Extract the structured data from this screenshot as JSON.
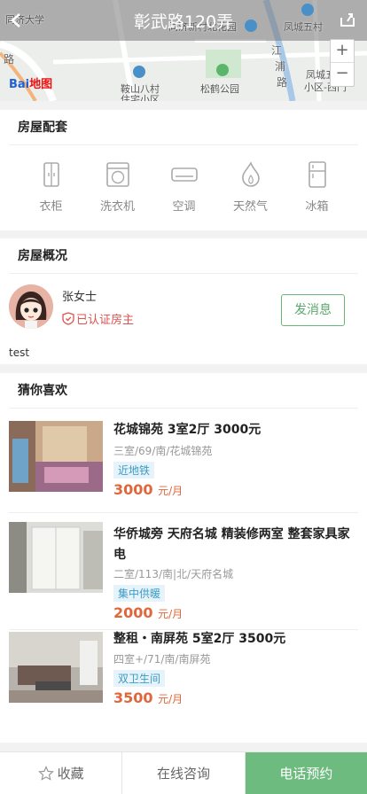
{
  "header": {
    "title": "彰武路120弄",
    "map_labels": {
      "label1": "同济大学",
      "label2": "同济新村北花园",
      "label3": "凤城五村",
      "label4": "鞍山八村",
      "label4b": "住宅小区",
      "label5": "松鹤公园",
      "label6": "凤城五",
      "label6b": "小区-西门",
      "label7": "江",
      "label8": "浦",
      "label9": "路",
      "label10": "路"
    },
    "baidu_logo": "Bai",
    "baidu_logo_suffix": "地图",
    "zoom_in": "+",
    "zoom_out": "−"
  },
  "facilities_section": {
    "title": "房屋配套",
    "items": [
      {
        "label": "衣柜",
        "icon": "wardrobe-icon"
      },
      {
        "label": "洗衣机",
        "icon": "washing-machine-icon"
      },
      {
        "label": "空调",
        "icon": "air-conditioner-icon"
      },
      {
        "label": "天然气",
        "icon": "gas-flame-icon"
      },
      {
        "label": "冰箱",
        "icon": "fridge-icon"
      }
    ]
  },
  "overview_section": {
    "title": "房屋概况",
    "owner_name": "张女士",
    "verified_label": "已认证房主",
    "message_button": "发消息",
    "description": "test"
  },
  "recommend_section": {
    "title": "猜你喜欢",
    "listings": [
      {
        "title": "花城锦苑 3室2厅 3000元",
        "meta": "三室/69/南/花城锦苑",
        "tag": "近地铁",
        "price": "3000",
        "unit": "元/月"
      },
      {
        "title": "华侨城旁 天府名城 精装修两室 整套家具家电",
        "meta": "二室/113/南|北/天府名城",
        "tag": "集中供暖",
        "price": "2000",
        "unit": "元/月"
      },
      {
        "title": "整租・南屏苑 5室2厅 3500元",
        "meta": "四室+/71/南/南屏苑",
        "tag": "双卫生间",
        "price": "3500",
        "unit": "元/月"
      }
    ]
  },
  "bottom_bar": {
    "favorite": "收藏",
    "consult": "在线咨询",
    "call": "电话预约"
  },
  "colors": {
    "accent_green": "#6dbb7f",
    "price_orange": "#e0663b",
    "verified_red": "#d9534f",
    "tag_blue": "#3c9bc4"
  }
}
